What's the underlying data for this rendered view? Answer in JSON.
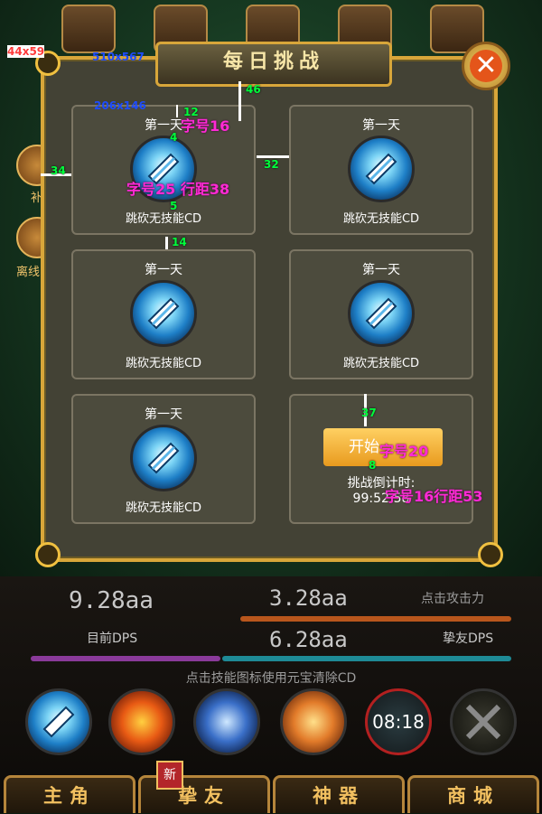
{
  "annotations": {
    "size_top_left": "44x59",
    "panel_size": "510x567",
    "card_size": "206x146",
    "gap_46": "46",
    "gap_12": "12",
    "gap_4": "4",
    "gap_5": "5",
    "gap_34": "34",
    "gap_32": "32",
    "gap_14": "14",
    "gap_37": "37",
    "gap_8": "8",
    "font16": "字号16",
    "font25": "字号25 行距38",
    "font20": "字号20",
    "font16b": "字号16行距53"
  },
  "side": {
    "label1": "补",
    "label2": "离线"
  },
  "dialog": {
    "title": "每日挑战",
    "close_icon": "close-x-icon",
    "cards": [
      {
        "day": "第一天",
        "name": "跳砍无技能CD"
      },
      {
        "day": "第一天",
        "name": "跳砍无技能CD"
      },
      {
        "day": "第一天",
        "name": "跳砍无技能CD"
      },
      {
        "day": "第一天",
        "name": "跳砍无技能CD"
      },
      {
        "day": "第一天",
        "name": "跳砍无技能CD"
      }
    ],
    "challenge": {
      "start_label": "开始",
      "countdown_label": "挑战倒计时:",
      "countdown_value": "99:52:58"
    }
  },
  "stats": {
    "current_dps_value": "9.28aa",
    "current_dps_label": "目前DPS",
    "attack_value": "3.28aa",
    "attack_label": "点击攻击力",
    "friend_dps_value": "6.28aa",
    "friend_dps_label": "挚友DPS"
  },
  "hint": "点击技能图标使用元宝清除CD",
  "skills": {
    "cooldown_text": "08:18"
  },
  "tabs": {
    "hero": "主角",
    "friends": "挚友",
    "artifact": "神器",
    "shop": "商城",
    "new_badge": "新"
  },
  "colors": {
    "gold_border": "#d8a63a",
    "panel_bg": "#434235",
    "start_button": "#f4b43a",
    "close_button": "#e4551a"
  }
}
